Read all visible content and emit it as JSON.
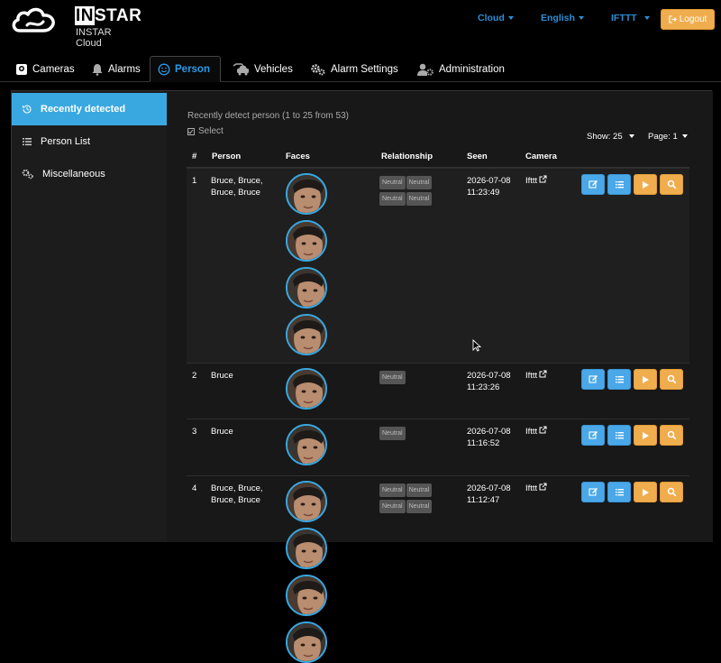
{
  "brand": {
    "name_in": "IN",
    "name_rest": "STAR",
    "subtitle": "INSTAR Cloud"
  },
  "topnav": {
    "cloud": "Cloud",
    "language": "English",
    "ifttt": "IFTTT",
    "logout": "Logout"
  },
  "tabs": [
    {
      "label": "Cameras",
      "icon": "camera-icon"
    },
    {
      "label": "Alarms",
      "icon": "bell-icon"
    },
    {
      "label": "Person",
      "icon": "smile-icon",
      "active": true
    },
    {
      "label": "Vehicles",
      "icon": "car-icon"
    },
    {
      "label": "Alarm Settings",
      "icon": "gears-icon"
    },
    {
      "label": "Administration",
      "icon": "user-gear-icon"
    }
  ],
  "sidebar": {
    "items": [
      {
        "label": "Recently detected",
        "icon": "history-icon",
        "active": true
      },
      {
        "label": "Person List",
        "icon": "list-icon"
      },
      {
        "label": "Miscellaneous",
        "icon": "gears-icon"
      }
    ]
  },
  "content": {
    "title": "Recently detect person (1 to 25 from 53)",
    "select_label": "Select",
    "show": "Show: 25",
    "page": "Page: 1",
    "columns": [
      "#",
      "Person",
      "Faces",
      "Relationship",
      "Seen",
      "Camera"
    ],
    "rows": [
      {
        "num": "1",
        "person": "Bruce, Bruce, Bruce, Bruce",
        "faces": 4,
        "relationships": [
          "Neutral",
          "Neutral",
          "Neutral",
          "Neutral"
        ],
        "date": "2026-07-08",
        "time": "11:23:49",
        "camera": "Ifttt"
      },
      {
        "num": "2",
        "person": "Bruce",
        "faces": 1,
        "relationships": [
          "Neutral"
        ],
        "date": "2026-07-08",
        "time": "11:23:26",
        "camera": "Ifttt"
      },
      {
        "num": "3",
        "person": "Bruce",
        "faces": 1,
        "relationships": [
          "Neutral"
        ],
        "date": "2026-07-08",
        "time": "11:16:52",
        "camera": "Ifttt"
      },
      {
        "num": "4",
        "person": "Bruce, Bruce, Bruce, Bruce",
        "faces": 4,
        "relationships": [
          "Neutral",
          "Neutral",
          "Neutral",
          "Neutral"
        ],
        "date": "2026-07-08",
        "time": "11:12:47",
        "camera": "Ifttt"
      }
    ]
  },
  "colors": {
    "accent": "#3aa8e0",
    "button_blue": "#4aa8e8",
    "button_orange": "#f0ad4e",
    "link": "#2b8ed6"
  }
}
